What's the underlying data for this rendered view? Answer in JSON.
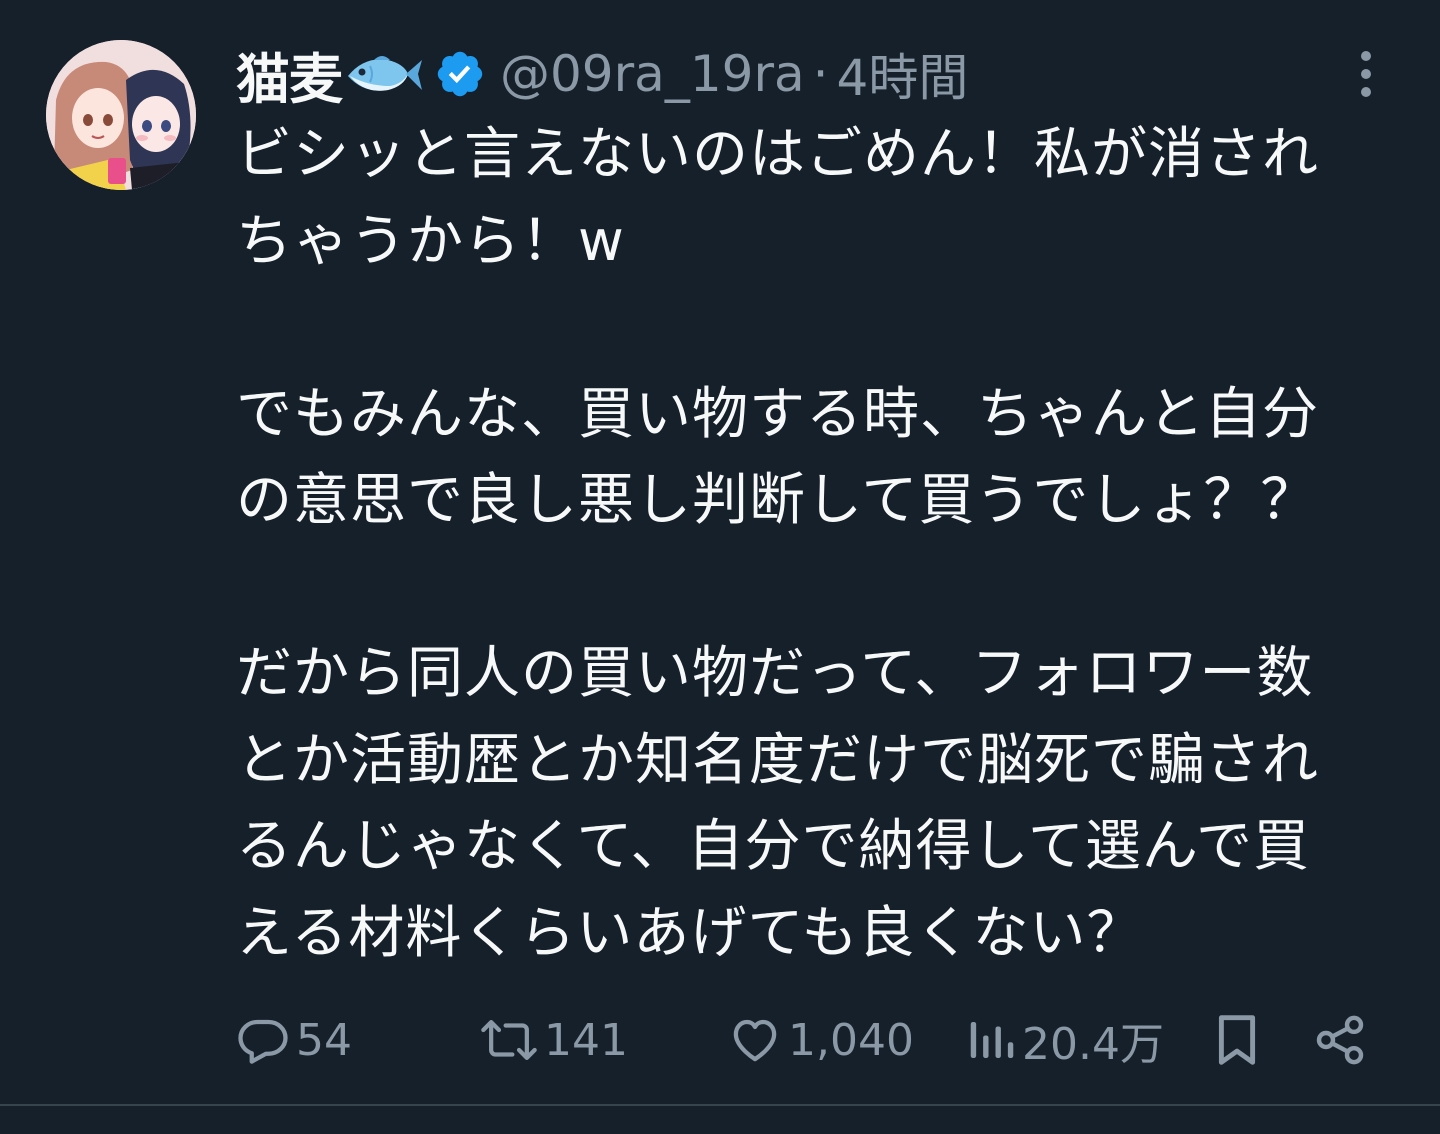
{
  "author": {
    "display_name": "猫麦",
    "name_emoji_icon": "fish-icon",
    "verified_icon": "verified-badge-icon",
    "handle": "@09ra_19ra",
    "separator": "·",
    "time": "4時間"
  },
  "tweet": {
    "paragraphs": [
      [
        "ビシッと言えないのはごめん！私が消され",
        "ちゃうから！w"
      ],
      [
        "でもみんな、買い物する時、ちゃんと自分",
        "の意思で良し悪し判断して買うでしょ？？"
      ],
      [
        "だから同人の買い物だって、フォロワー数",
        "とか活動歴とか知名度だけで脳死で騙され",
        "るんじゃなくて、自分で納得して選んで買",
        "える材料くらいあげても良くない？"
      ]
    ]
  },
  "actions": {
    "reply_count": "54",
    "retweet_count": "141",
    "like_count": "1,040",
    "view_count": "20.4万"
  },
  "colors": {
    "background": "#15202b",
    "text": "#f7f9f9",
    "muted": "#8b98a5",
    "verified": "#1d9bf0",
    "divider": "#38444d"
  }
}
